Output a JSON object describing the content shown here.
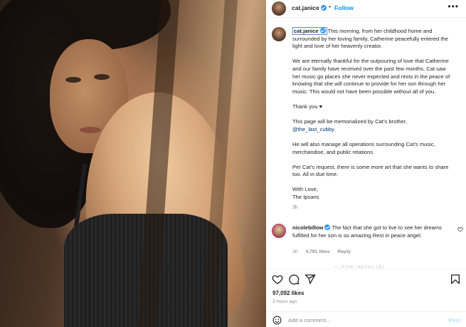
{
  "post": {
    "username": "cat.janice",
    "separator": "•",
    "follow_label": "Follow",
    "more_icon": "more-horizontal-icon"
  },
  "caption": {
    "username": "cat.janice",
    "p1": "This morning, from her childhood home and surrounded by her loving family, Catherine peacefully entered the light and love of her heavenly creator.",
    "p2": "We are eternally thankful for the outpouring of love that Catherine and our family have received over the past few months. Cat saw her music go places she never expected and rests in the peace of knowing that she will continue to provide for her son through her music. This would not have been possible without all of you.",
    "p3": "Thank you ♥",
    "p4_text": "This page will be memorialized by Cat’s brother,",
    "p4_mention": "@the_last_cubby",
    "p5": "He will also manage all operations surrounding Cat’s music, merchandise, and public relations.",
    "p6": "Per Cat’s request, there is some more art that she wants to share too. All in due time.",
    "p7_line1": "With Love,",
    "p7_line2": "The Ipsans",
    "time": "3h"
  },
  "comment": {
    "username": "nicolebillow",
    "text": "The fact that she got to live to see her dreams fulfilled for her son is so amazing.Rest in peace angel.",
    "time": "3h",
    "likes": "4,781 likes",
    "reply_label": "Reply",
    "partial_text": "— View replies (8)"
  },
  "actions": {
    "icons": [
      "heart-icon",
      "comment-icon",
      "share-icon",
      "bookmark-icon"
    ]
  },
  "stats": {
    "likes": "97,092 likes",
    "posted": "3 hours ago"
  },
  "add_comment": {
    "placeholder": "Add a comment...",
    "post_label": "Post"
  },
  "colors": {
    "accent": "#0095f6",
    "verified": "#3897f0",
    "post_disabled": "#b2dffc",
    "muted": "#8e8e8e"
  }
}
